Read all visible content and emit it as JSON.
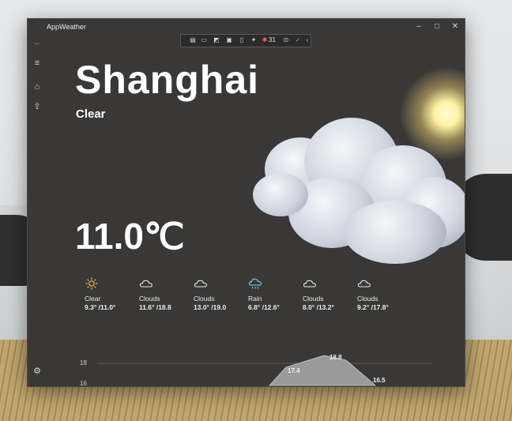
{
  "window": {
    "title": "AppWeather",
    "controls": {
      "minimize": "–",
      "maximize": "□",
      "close": "✕"
    }
  },
  "toolbar": {
    "icons": [
      "document-edit-icon",
      "video-icon",
      "cast-icon",
      "stop-icon",
      "phone-icon",
      "antenna-icon",
      "bug-icon",
      "timer-icon",
      "check-icon",
      "chevron-left-icon"
    ],
    "count": "31"
  },
  "nav": {
    "back_icon": "back-arrow-icon",
    "menu_icon": "hamburger-menu-icon",
    "home_icon": "home-icon",
    "share_icon": "share-icon",
    "settings_icon": "settings-gear-icon"
  },
  "current": {
    "city": "Shanghai",
    "condition": "Clear",
    "temperature": "11.0℃"
  },
  "forecast": [
    {
      "icon": "sun-icon",
      "label": "Clear",
      "range": "9.3° /11.0°",
      "color": "#f2c94c"
    },
    {
      "icon": "cloud-icon",
      "label": "Clouds",
      "range": "11.6° /18.8",
      "color": "#e6e6e6"
    },
    {
      "icon": "cloud-icon",
      "label": "Clouds",
      "range": "13.0° /19.0",
      "color": "#e6e6e6"
    },
    {
      "icon": "rain-cloud-icon",
      "label": "Rain",
      "range": "6.8° /12.6°",
      "color": "#7fd0f0"
    },
    {
      "icon": "cloud-icon",
      "label": "Clouds",
      "range": "8.0° /13.2°",
      "color": "#e6e6e6"
    },
    {
      "icon": "cloud-icon",
      "label": "Clouds",
      "range": "9.2° /17.8°",
      "color": "#e6e6e6"
    }
  ],
  "chart": {
    "y_ticks": [
      "18",
      "16"
    ],
    "point_labels": [
      "18.8",
      "17.4",
      "16.5"
    ],
    "area_color": "#9a9a9a"
  }
}
